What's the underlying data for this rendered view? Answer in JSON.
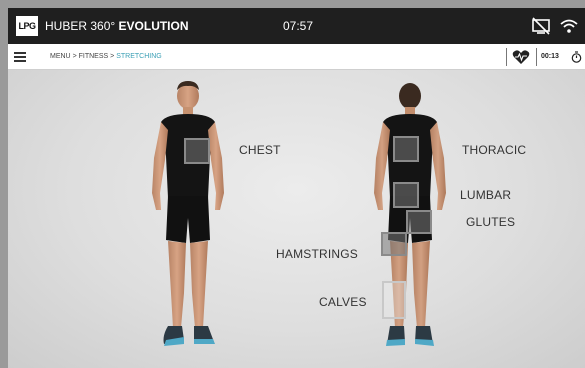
{
  "app": {
    "logo": "LPG",
    "brand_prefix": "HUBER 360°",
    "brand_suffix": "EVOLUTION",
    "clock": "07:57",
    "icons": {
      "screen": "screen-off-icon",
      "wifi": "wifi-icon"
    }
  },
  "breadcrumb": {
    "menu": "MENU",
    "separator": ">",
    "fitness": "FITNESS",
    "current": "STRETCHING",
    "current_color": "#3a9fb5"
  },
  "status": {
    "timer": "00:13",
    "icons": {
      "heart": "heart-rate-icon",
      "stopwatch": "stopwatch-icon",
      "menu": "hamburger-menu-icon"
    }
  },
  "zones": {
    "chest": "CHEST",
    "thoracic": "THORACIC",
    "lumbar": "LUMBAR",
    "glutes": "GLUTES",
    "hamstrings": "HAMSTRINGS",
    "calves": "CALVES"
  },
  "colors": {
    "topbar": "#1f1f1f",
    "accent": "#3a9fb5",
    "zone_fill": "#8a8a8a"
  }
}
